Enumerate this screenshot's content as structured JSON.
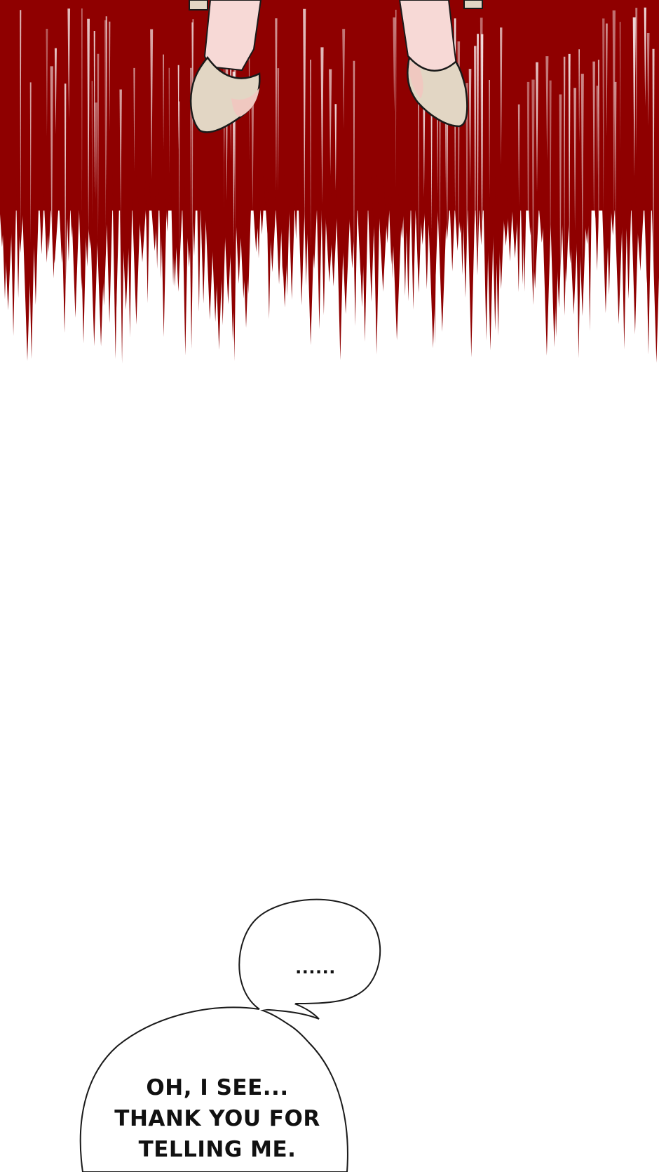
{
  "panel_top": {
    "background_color": "#8f0000",
    "shoe_color": "#e2d6c4",
    "leg_color": "#f7d9d6"
  },
  "bubble_small": {
    "text": "......"
  },
  "bubble_large": {
    "lines": [
      "OH, I SEE...",
      "THANK YOU FOR",
      "TELLING ME."
    ]
  }
}
